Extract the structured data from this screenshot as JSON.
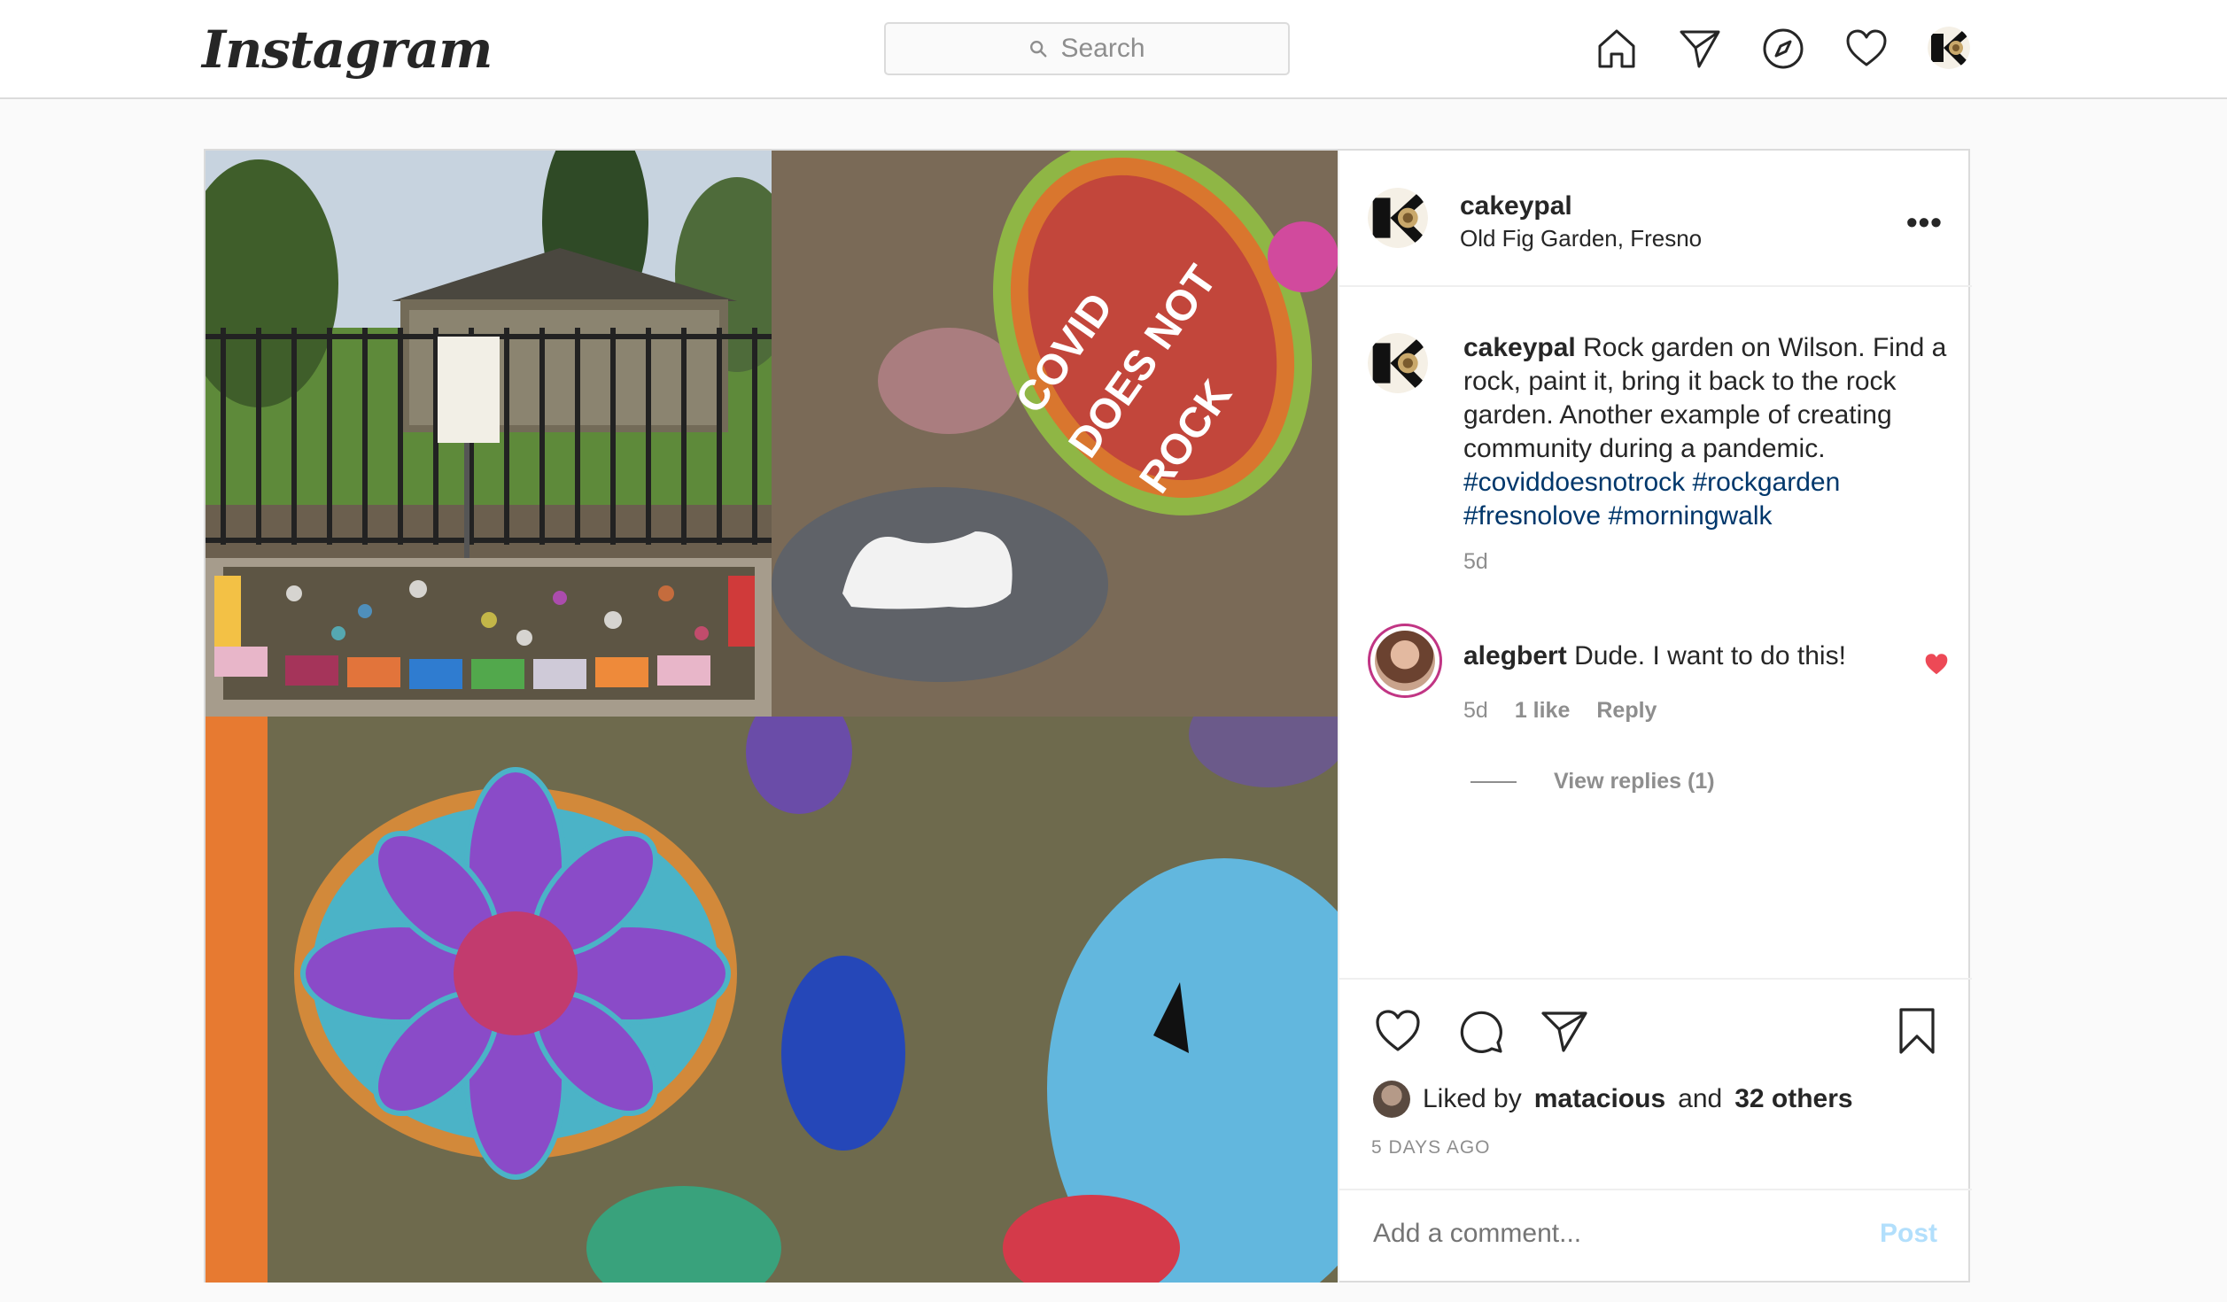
{
  "nav": {
    "logo": "Instagram",
    "search_placeholder": "Search",
    "icons": [
      "home-icon",
      "direct-icon",
      "explore-icon",
      "activity-heart-icon",
      "profile-avatar"
    ]
  },
  "post": {
    "author": "cakeypal",
    "location": "Old Fig Garden, Fresno",
    "more_label": "•••",
    "caption": {
      "user": "cakeypal",
      "text": "Rock garden on Wilson. Find a rock, paint it, bring it back to the rock garden. Another example of creating community during a pandemic.",
      "hashtags": [
        "#coviddoesnotrock",
        "#rockgarden",
        "#fresnolove",
        "#morningwalk"
      ],
      "time": "5d"
    },
    "comment": {
      "user": "alegbert",
      "text": "Dude. I want to do this!",
      "time": "5d",
      "likes": "1 like",
      "reply": "Reply",
      "view_replies": "View replies (1)"
    },
    "likes": {
      "prefix": "Liked by",
      "user": "matacious",
      "and": "and",
      "others": "32 others"
    },
    "date": "5 DAYS AGO",
    "add_comment_placeholder": "Add a comment...",
    "post_button": "Post",
    "colors": {
      "link": "#00376b",
      "post_disabled": "#b2dffc",
      "liked_heart": "#ed4956"
    }
  }
}
